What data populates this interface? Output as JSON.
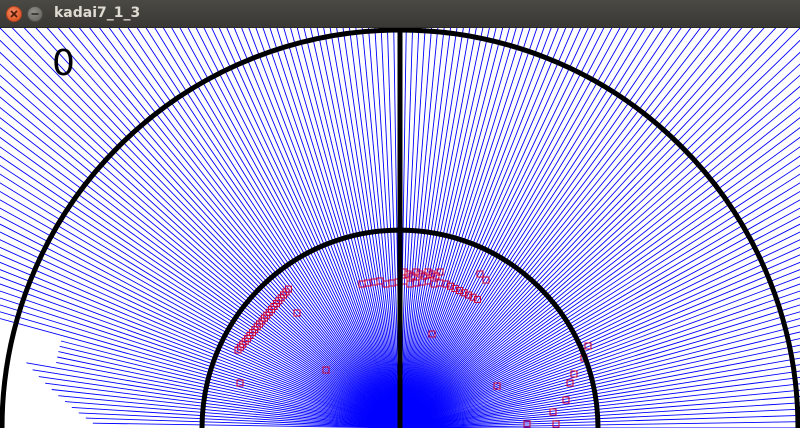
{
  "window": {
    "title": "kadai7_1_3",
    "close_icon": "close-icon",
    "minimize_icon": "minimize-icon"
  },
  "display": {
    "counter": "0"
  },
  "colors": {
    "rays": "#0000ff",
    "points": "#cc0033",
    "arcs": "#000000",
    "titlebar": "#3c3b37",
    "close": "#e95420"
  }
}
